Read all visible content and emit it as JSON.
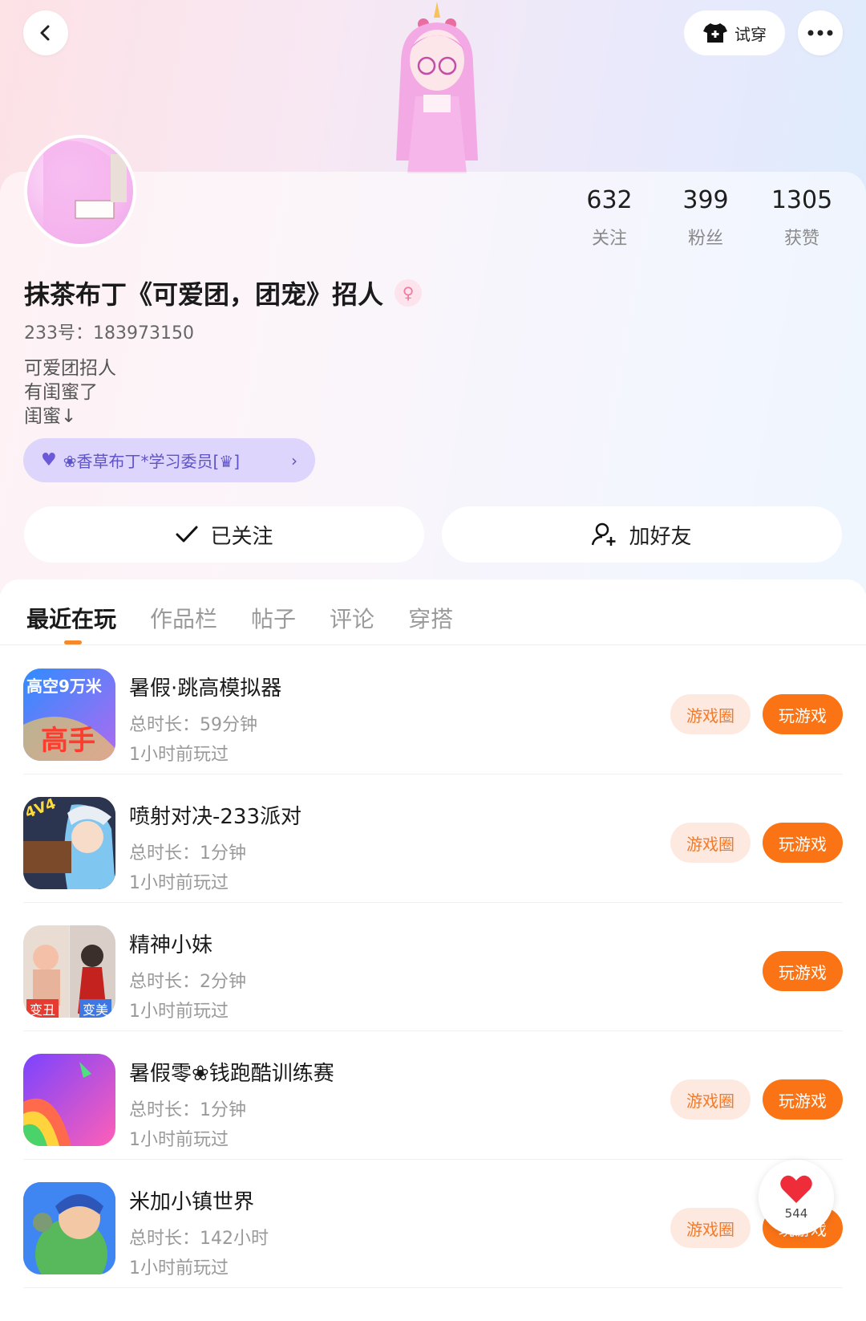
{
  "header": {
    "try_on_label": "试穿"
  },
  "profile": {
    "name": "抹茶布丁《可爱团，团宠》招人",
    "gender_symbol": "♀",
    "account_id": "233号：183973150",
    "bio_lines": [
      "可爱团招人",
      "有闺蜜了",
      "闺蜜↓"
    ],
    "family_tag": "❀香草布丁*学习委员[♛]",
    "stats": [
      {
        "value": "632",
        "label": "关注"
      },
      {
        "value": "399",
        "label": "粉丝"
      },
      {
        "value": "1305",
        "label": "获赞"
      }
    ]
  },
  "actions": {
    "followed_label": "已关注",
    "add_friend_label": "加好友"
  },
  "tabs": [
    {
      "label": "最近在玩",
      "active": true
    },
    {
      "label": "作品栏",
      "active": false
    },
    {
      "label": "帖子",
      "active": false
    },
    {
      "label": "评论",
      "active": false
    },
    {
      "label": "穿搭",
      "active": false
    }
  ],
  "games": [
    {
      "title": "暑假·跳高模拟器",
      "duration": "总时长：59分钟",
      "last_played": "1小时前玩过",
      "circle_label": "游戏圈",
      "play_label": "玩游戏",
      "icon_text_top": "高空9万米",
      "icon_text_bottom": "高手"
    },
    {
      "title": "喷射对决-233派对",
      "duration": "总时长：1分钟",
      "last_played": "1小时前玩过",
      "circle_label": "游戏圈",
      "play_label": "玩游戏",
      "icon_text_top": "4V4"
    },
    {
      "title": "精神小妹",
      "duration": "总时长：2分钟",
      "last_played": "1小时前玩过",
      "play_label": "玩游戏",
      "icon_text_left": "变丑",
      "icon_text_right": "变美"
    },
    {
      "title": "暑假零❀钱跑酷训练赛",
      "duration": "总时长：1分钟",
      "last_played": "1小时前玩过",
      "circle_label": "游戏圈",
      "play_label": "玩游戏"
    },
    {
      "title": "米加小镇世界",
      "duration": "总时长：142小时",
      "last_played": "1小时前玩过",
      "circle_label": "游戏圈",
      "play_label": "玩游戏"
    }
  ],
  "floating_like": {
    "count": "544"
  },
  "colors": {
    "accent_orange": "#fa7416",
    "circle_bg": "#fde9df",
    "family_tag_bg": "#ddd5fb"
  }
}
